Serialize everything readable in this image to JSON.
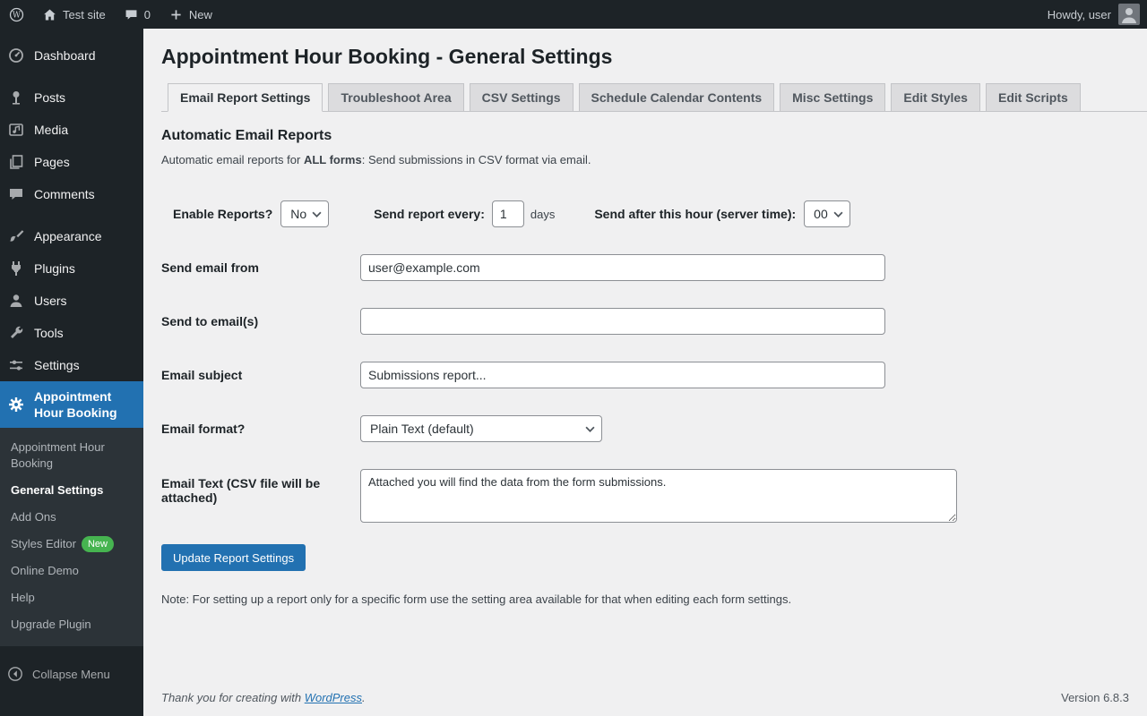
{
  "admin_bar": {
    "site_name": "Test site",
    "comments_count": "0",
    "new_label": "New",
    "howdy_text": "Howdy, user"
  },
  "sidebar": {
    "menu": [
      {
        "label": "Dashboard"
      },
      {
        "label": "Posts"
      },
      {
        "label": "Media"
      },
      {
        "label": "Pages"
      },
      {
        "label": "Comments"
      },
      {
        "label": "Appearance"
      },
      {
        "label": "Plugins"
      },
      {
        "label": "Users"
      },
      {
        "label": "Tools"
      },
      {
        "label": "Settings"
      },
      {
        "label": "Appointment Hour Booking"
      }
    ],
    "submenu": [
      {
        "label": "Appointment Hour Booking"
      },
      {
        "label": "General Settings"
      },
      {
        "label": "Add Ons"
      },
      {
        "label": "Styles Editor",
        "badge": "New"
      },
      {
        "label": "Online Demo"
      },
      {
        "label": "Help"
      },
      {
        "label": "Upgrade Plugin"
      }
    ],
    "collapse_label": "Collapse Menu"
  },
  "page": {
    "title": "Appointment Hour Booking - General Settings",
    "tabs": [
      {
        "label": "Email Report Settings"
      },
      {
        "label": "Troubleshoot Area"
      },
      {
        "label": "CSV Settings"
      },
      {
        "label": "Schedule Calendar Contents"
      },
      {
        "label": "Misc Settings"
      },
      {
        "label": "Edit Styles"
      },
      {
        "label": "Edit Scripts"
      }
    ],
    "section_title": "Automatic Email Reports",
    "intro": {
      "prefix": "Automatic email reports for ",
      "bold": "ALL forms",
      "suffix": ": Send submissions in CSV format via email."
    },
    "form": {
      "enable_label": "Enable Reports?",
      "enable_value": "No",
      "every_label": "Send report every:",
      "every_value": "1",
      "every_unit": "days",
      "hour_label": "Send after this hour (server time):",
      "hour_value": "00",
      "from_label": "Send email from",
      "from_value": "user@example.com",
      "to_label": "Send to email(s)",
      "to_value": "",
      "subject_label": "Email subject",
      "subject_value": "Submissions report...",
      "format_label": "Email format?",
      "format_value": "Plain Text (default)",
      "body_label": "Email Text (CSV file will be attached)",
      "body_value": "Attached you will find the data from the form submissions.",
      "submit_label": "Update Report Settings"
    },
    "note": "Note: For setting up a report only for a specific form use the setting area available for that when editing each form settings."
  },
  "footer": {
    "thanks_prefix": "Thank you for creating with ",
    "thanks_link": "WordPress",
    "thanks_suffix": ".",
    "version": "Version 6.8.3"
  },
  "colors": {
    "accent": "#2271b1",
    "admin_dark": "#1d2327",
    "submenu_bg": "#2c3338",
    "badge_green": "#46b450",
    "content_bg": "#f0f0f1"
  }
}
